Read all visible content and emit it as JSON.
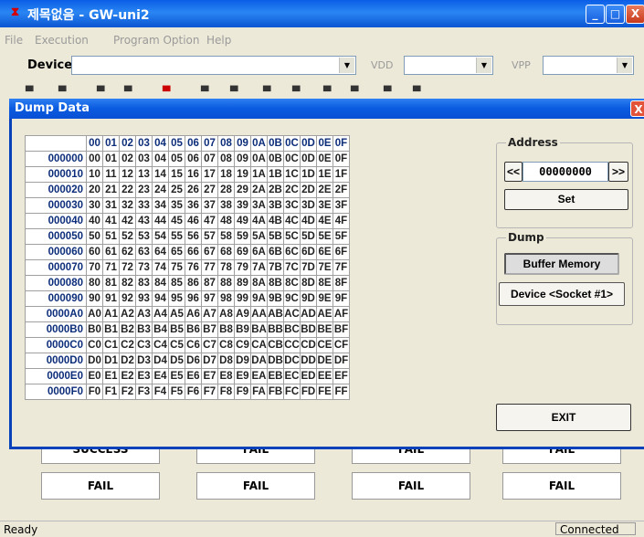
{
  "window": {
    "app_icon": "chip-icon",
    "title": "제목없음 - GW-uni2",
    "minimize": "_",
    "maximize": "□",
    "close": "X"
  },
  "menu": [
    "File",
    "Execution",
    "Program Option",
    "Help"
  ],
  "device_bar": {
    "device_label": "Device",
    "device_value": "",
    "vdd_label": "VDD",
    "vdd_value": "",
    "vpp_label": "VPP",
    "vpp_value": ""
  },
  "results": {
    "row1": [
      "SUCCESS",
      "FAIL",
      "FAIL",
      "FAIL"
    ],
    "row2": [
      "FAIL",
      "FAIL",
      "FAIL",
      "FAIL"
    ]
  },
  "status": {
    "left": "Ready",
    "right": "Connected"
  },
  "dialog": {
    "title": "Dump Data",
    "close": "X",
    "columns": [
      "00",
      "01",
      "02",
      "03",
      "04",
      "05",
      "06",
      "07",
      "08",
      "09",
      "0A",
      "0B",
      "0C",
      "0D",
      "0E",
      "0F"
    ],
    "rows": [
      {
        "addr": "000000",
        "bytes": [
          "00",
          "01",
          "02",
          "03",
          "04",
          "05",
          "06",
          "07",
          "08",
          "09",
          "0A",
          "0B",
          "0C",
          "0D",
          "0E",
          "0F"
        ]
      },
      {
        "addr": "000010",
        "bytes": [
          "10",
          "11",
          "12",
          "13",
          "14",
          "15",
          "16",
          "17",
          "18",
          "19",
          "1A",
          "1B",
          "1C",
          "1D",
          "1E",
          "1F"
        ]
      },
      {
        "addr": "000020",
        "bytes": [
          "20",
          "21",
          "22",
          "23",
          "24",
          "25",
          "26",
          "27",
          "28",
          "29",
          "2A",
          "2B",
          "2C",
          "2D",
          "2E",
          "2F"
        ]
      },
      {
        "addr": "000030",
        "bytes": [
          "30",
          "31",
          "32",
          "33",
          "34",
          "35",
          "36",
          "37",
          "38",
          "39",
          "3A",
          "3B",
          "3C",
          "3D",
          "3E",
          "3F"
        ]
      },
      {
        "addr": "000040",
        "bytes": [
          "40",
          "41",
          "42",
          "43",
          "44",
          "45",
          "46",
          "47",
          "48",
          "49",
          "4A",
          "4B",
          "4C",
          "4D",
          "4E",
          "4F"
        ]
      },
      {
        "addr": "000050",
        "bytes": [
          "50",
          "51",
          "52",
          "53",
          "54",
          "55",
          "56",
          "57",
          "58",
          "59",
          "5A",
          "5B",
          "5C",
          "5D",
          "5E",
          "5F"
        ]
      },
      {
        "addr": "000060",
        "bytes": [
          "60",
          "61",
          "62",
          "63",
          "64",
          "65",
          "66",
          "67",
          "68",
          "69",
          "6A",
          "6B",
          "6C",
          "6D",
          "6E",
          "6F"
        ]
      },
      {
        "addr": "000070",
        "bytes": [
          "70",
          "71",
          "72",
          "73",
          "74",
          "75",
          "76",
          "77",
          "78",
          "79",
          "7A",
          "7B",
          "7C",
          "7D",
          "7E",
          "7F"
        ]
      },
      {
        "addr": "000080",
        "bytes": [
          "80",
          "81",
          "82",
          "83",
          "84",
          "85",
          "86",
          "87",
          "88",
          "89",
          "8A",
          "8B",
          "8C",
          "8D",
          "8E",
          "8F"
        ]
      },
      {
        "addr": "000090",
        "bytes": [
          "90",
          "91",
          "92",
          "93",
          "94",
          "95",
          "96",
          "97",
          "98",
          "99",
          "9A",
          "9B",
          "9C",
          "9D",
          "9E",
          "9F"
        ]
      },
      {
        "addr": "0000A0",
        "bytes": [
          "A0",
          "A1",
          "A2",
          "A3",
          "A4",
          "A5",
          "A6",
          "A7",
          "A8",
          "A9",
          "AA",
          "AB",
          "AC",
          "AD",
          "AE",
          "AF"
        ]
      },
      {
        "addr": "0000B0",
        "bytes": [
          "B0",
          "B1",
          "B2",
          "B3",
          "B4",
          "B5",
          "B6",
          "B7",
          "B8",
          "B9",
          "BA",
          "BB",
          "BC",
          "BD",
          "BE",
          "BF"
        ]
      },
      {
        "addr": "0000C0",
        "bytes": [
          "C0",
          "C1",
          "C2",
          "C3",
          "C4",
          "C5",
          "C6",
          "C7",
          "C8",
          "C9",
          "CA",
          "CB",
          "CC",
          "CD",
          "CE",
          "CF"
        ]
      },
      {
        "addr": "0000D0",
        "bytes": [
          "D0",
          "D1",
          "D2",
          "D3",
          "D4",
          "D5",
          "D6",
          "D7",
          "D8",
          "D9",
          "DA",
          "DB",
          "DC",
          "DD",
          "DE",
          "DF"
        ]
      },
      {
        "addr": "0000E0",
        "bytes": [
          "E0",
          "E1",
          "E2",
          "E3",
          "E4",
          "E5",
          "E6",
          "E7",
          "E8",
          "E9",
          "EA",
          "EB",
          "EC",
          "ED",
          "EE",
          "EF"
        ]
      },
      {
        "addr": "0000F0",
        "bytes": [
          "F0",
          "F1",
          "F2",
          "F3",
          "F4",
          "F5",
          "F6",
          "F7",
          "F8",
          "F9",
          "FA",
          "FB",
          "FC",
          "FD",
          "FE",
          "FF"
        ]
      }
    ],
    "address_group": {
      "title": "Address",
      "prev": "<<",
      "value": "00000000",
      "next": ">>",
      "set": "Set"
    },
    "dump_group": {
      "title": "Dump",
      "buffer_memory": "Buffer Memory",
      "device_socket": "Device <Socket #1>"
    },
    "exit": "EXIT"
  }
}
